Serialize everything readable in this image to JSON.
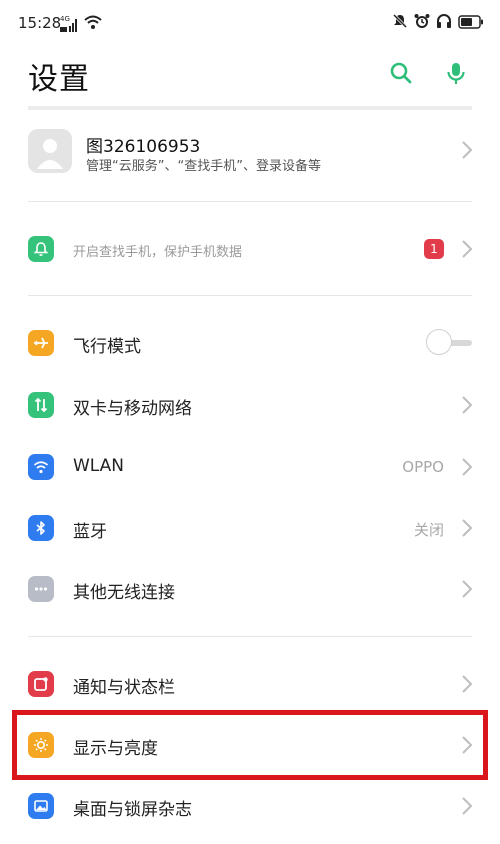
{
  "status_bar": {
    "time": "15:28",
    "network_label": "4G"
  },
  "header": {
    "title": "设置"
  },
  "account": {
    "name": "图326106953",
    "description": "管理“云服务”、“查找手机”、登录设备等"
  },
  "find_phone": {
    "label": "开启查找手机，保护手机数据",
    "badge_count": "1"
  },
  "settings": [
    {
      "label": "飞行模式",
      "icon": "airplane-icon",
      "color": "#f5a623",
      "control": "toggle",
      "toggle_on": false
    },
    {
      "label": "双卡与移动网络",
      "icon": "dual-sim-icon",
      "color": "#35c27a",
      "control": "chevron"
    },
    {
      "label": "WLAN",
      "icon": "wifi-icon",
      "color": "#2f7cf0",
      "value": "OPPO",
      "control": "chevron"
    },
    {
      "label": "蓝牙",
      "icon": "bluetooth-icon",
      "color": "#2f7cf0",
      "value": "关闭",
      "control": "chevron"
    },
    {
      "label": "其他无线连接",
      "icon": "more-connections-icon",
      "color": "#b7bcc7",
      "control": "chevron"
    },
    {
      "label": "通知与状态栏",
      "icon": "notification-icon",
      "color": "#e23c4a",
      "control": "chevron"
    },
    {
      "label": "显示与亮度",
      "icon": "brightness-icon",
      "color": "#f5a623",
      "control": "chevron",
      "highlighted": true
    },
    {
      "label": "桌面与锁屏杂志",
      "icon": "wallpaper-icon",
      "color": "#2f7cf0",
      "control": "chevron"
    }
  ],
  "colors": {
    "accent_green": "#2fbf7a",
    "highlight_red": "#d8161b"
  }
}
